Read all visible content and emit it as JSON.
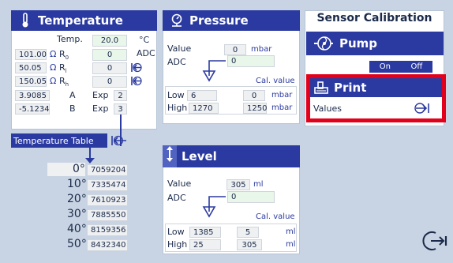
{
  "temperature": {
    "title": "Temperature",
    "temp_label": "Temp.",
    "temp_value": "20.0",
    "temp_unit": "°C",
    "rows": [
      {
        "value": "101.00",
        "ohm": "Ω",
        "sym": "R",
        "sub": "0",
        "adc": "0"
      },
      {
        "value": "50.05",
        "ohm": "Ω",
        "sym": "R",
        "sub": "l",
        "adc": "0"
      },
      {
        "value": "150.05",
        "ohm": "Ω",
        "sym": "R",
        "sub": "h",
        "adc": "0"
      }
    ],
    "adc_label": "ADC",
    "coef": [
      {
        "value": "3.9085",
        "name": "A",
        "exp_label": "Exp",
        "exp": "2"
      },
      {
        "value": "-5.1234",
        "name": "B",
        "exp_label": "Exp",
        "exp": "3"
      }
    ],
    "table_label": "Temperature Table",
    "table": [
      {
        "deg": "0°",
        "val": "7059204"
      },
      {
        "deg": "10°",
        "val": "7335474"
      },
      {
        "deg": "20°",
        "val": "7610923"
      },
      {
        "deg": "30°",
        "val": "7885550"
      },
      {
        "deg": "40°",
        "val": "8159356"
      },
      {
        "deg": "50°",
        "val": "8432340"
      }
    ]
  },
  "pressure": {
    "title": "Pressure",
    "value_label": "Value",
    "value": "0",
    "unit": "mbar",
    "adc_label": "ADC",
    "adc": "0",
    "cal_label": "Cal. value",
    "low_label": "Low",
    "low": "6",
    "low_cal": "0",
    "high_label": "High",
    "high": "1270",
    "high_cal": "1250"
  },
  "level": {
    "title": "Level",
    "value_label": "Value",
    "value": "305",
    "unit": "ml",
    "adc_label": "ADC",
    "adc": "0",
    "cal_label": "Cal. value",
    "low_label": "Low",
    "low": "1385",
    "low_cal": "5",
    "high_label": "High",
    "high": "25",
    "high_cal": "305"
  },
  "calibration": {
    "title": "Sensor Calibration",
    "pump_title": "Pump",
    "on_label": "On",
    "off_label": "Off",
    "print_title": "Print",
    "values_label": "Values"
  },
  "colors": {
    "header": "#2b3aa0",
    "highlight": "#e3001b",
    "background": "#c8d4e3"
  }
}
